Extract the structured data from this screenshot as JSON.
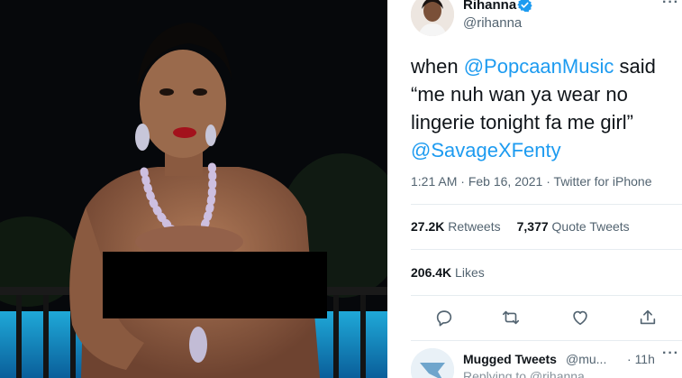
{
  "tweet": {
    "display_name": "Rihanna",
    "handle": "@rihanna",
    "text_parts": [
      {
        "text": "when ",
        "kind": "text"
      },
      {
        "text": "@PopcaanMusic",
        "kind": "mention"
      },
      {
        "text": " said “me nuh wan ya wear no lingerie tonight fa me girl” ",
        "kind": "text"
      },
      {
        "text": "@SavageXFenty",
        "kind": "mention"
      }
    ],
    "time": "1:21 AM",
    "date": "Feb 16, 2021",
    "separator": "·",
    "source": "Twitter for iPhone"
  },
  "stats": {
    "retweets_count": "27.2K",
    "retweets_label": "Retweets",
    "quotes_count": "7,377",
    "quotes_label": "Quote Tweets",
    "likes_count": "206.4K",
    "likes_label": "Likes"
  },
  "actions": [
    "reply-icon",
    "retweet-icon",
    "like-icon",
    "share-icon"
  ],
  "reply": {
    "name": "Mugged Tweets",
    "handle": "@mu...",
    "separator": "·",
    "time": "11h",
    "sub": "Replying to @rihanna"
  },
  "colors": {
    "link": "#1d9bf0",
    "text": "#0f1419",
    "muted": "#536471",
    "divider": "#e6ecf0",
    "censor": "#000000"
  }
}
